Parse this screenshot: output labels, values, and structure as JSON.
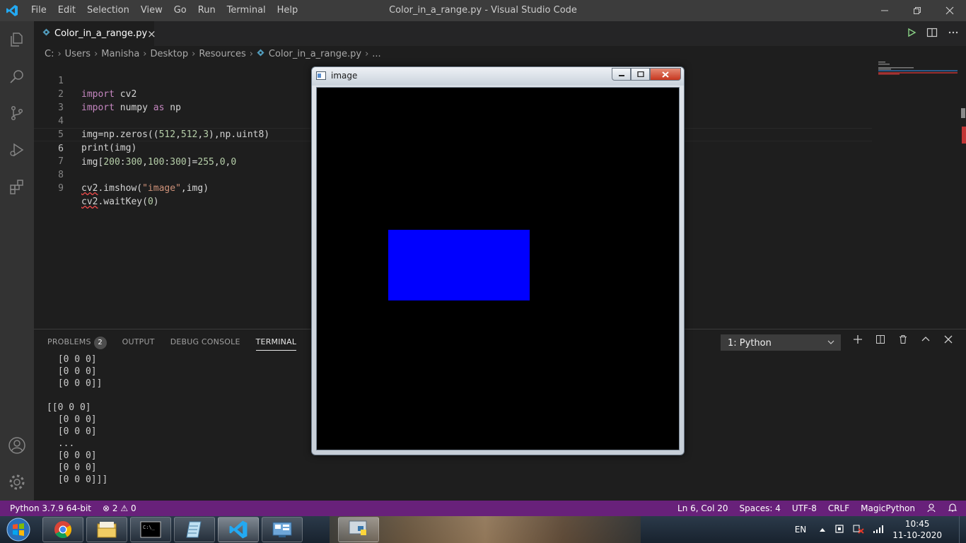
{
  "window": {
    "title": "Color_in_a_range.py - Visual Studio Code",
    "menu": [
      "File",
      "Edit",
      "Selection",
      "View",
      "Go",
      "Run",
      "Terminal",
      "Help"
    ]
  },
  "tab": {
    "label": "Color_in_a_range.py",
    "close": "×"
  },
  "breadcrumb": [
    "C:",
    "Users",
    "Manisha",
    "Desktop",
    "Resources",
    "Color_in_a_range.py",
    "..."
  ],
  "editor": {
    "line_numbers": [
      "1",
      "2",
      "3",
      "4",
      "5",
      "6",
      "7",
      "8",
      "9"
    ],
    "lines": [
      "import cv2",
      "import numpy as np",
      "",
      "img=np.zeros((512,512,3),np.uint8)",
      "print(img)",
      "img[200:300,100:300]=255,0,0",
      "",
      "cv2.imshow(\"image\",img)",
      "cv2.waitKey(0)"
    ]
  },
  "panel": {
    "tabs": [
      "PROBLEMS",
      "OUTPUT",
      "DEBUG CONSOLE",
      "TERMINAL"
    ],
    "problems_count": "2",
    "terminal_selector": "1: Python",
    "terminal_lines": [
      " [0 0 0]",
      " [0 0 0]",
      " [0 0 0]]",
      "",
      "[[0 0 0]",
      " [0 0 0]",
      " [0 0 0]",
      " ...",
      " [0 0 0]",
      " [0 0 0]",
      " [0 0 0]]]"
    ]
  },
  "cv_window": {
    "title": "image",
    "rect_color": "#0000ff",
    "canvas_color": "#000000"
  },
  "statusbar": {
    "interpreter": "Python 3.7.9 64-bit",
    "errors": "2",
    "warnings": "0",
    "position": "Ln 6, Col 20",
    "spaces": "Spaces: 4",
    "encoding": "UTF-8",
    "eol": "CRLF",
    "language": "MagicPython",
    "color": "#68217a"
  },
  "taskbar": {
    "language": "EN",
    "time": "10:45",
    "date": "11-10-2020"
  }
}
